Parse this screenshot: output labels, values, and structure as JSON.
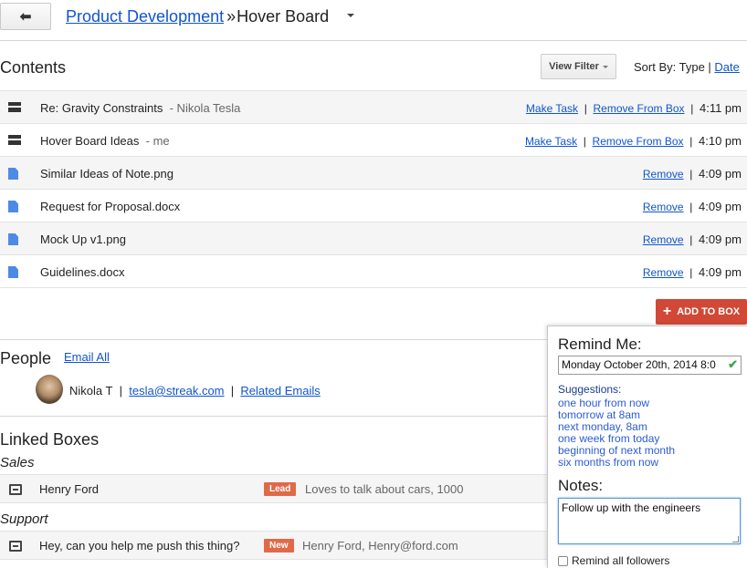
{
  "header": {
    "back_icon": "back-arrow-icon",
    "back_glyph": "⬅",
    "crumb_parent": "Product Development",
    "crumb_sep": "»",
    "crumb_current": "Hover Board"
  },
  "contents": {
    "title": "Contents",
    "view_filter": "View Filter",
    "sort_prefix": "Sort By: Type |",
    "sort_date": "Date",
    "rows": [
      {
        "type": "email",
        "title": "Re: Gravity Constraints",
        "from": "-  Nikola Tesla",
        "action1": "Make Task",
        "action2": "Remove From Box",
        "time": "4:11 pm"
      },
      {
        "type": "email",
        "title": "Hover Board Ideas",
        "from": "-  me",
        "action1": "Make Task",
        "action2": "Remove From Box",
        "time": "4:10 pm"
      },
      {
        "type": "file",
        "title": "Similar Ideas of Note.png",
        "action": "Remove",
        "time": "4:09 pm"
      },
      {
        "type": "file",
        "title": "Request for Proposal.docx",
        "action": "Remove",
        "time": "4:09 pm"
      },
      {
        "type": "file",
        "title": "Mock Up v1.png",
        "action": "Remove",
        "time": "4:09 pm"
      },
      {
        "type": "file",
        "title": "Guidelines.docx",
        "action": "Remove",
        "time": "4:09 pm"
      }
    ],
    "add_to_box": "ADD TO BOX"
  },
  "people": {
    "title": "People",
    "email_all": "Email All",
    "person_name": "Nikola T",
    "person_email": "tesla@streak.com",
    "related": "Related Emails"
  },
  "linked": {
    "title": "Linked Boxes",
    "groups": [
      {
        "label": "Sales",
        "name": "Henry Ford",
        "badge": "Lead",
        "desc": "Loves to talk about cars, 1000"
      },
      {
        "label": "Support",
        "name": "Hey, can you help me push this thing?",
        "badge": "New",
        "desc": "Henry Ford, Henry@ford.com"
      }
    ]
  },
  "reminder": {
    "title": "Remind Me:",
    "date_value": "Monday October 20th, 2014 8:0",
    "suggestions_label": "Suggestions:",
    "suggestions": [
      "one hour from now",
      "tomorrow at 8am",
      "next monday, 8am",
      "one week from today",
      "beginning of next month",
      "six months from now"
    ],
    "notes_title": "Notes:",
    "notes_value": "Follow up with the engineers",
    "remind_all": "Remind all followers"
  },
  "colors": {
    "link": "#1155cc",
    "accent": "#d14836",
    "badge": "#e06a48"
  }
}
